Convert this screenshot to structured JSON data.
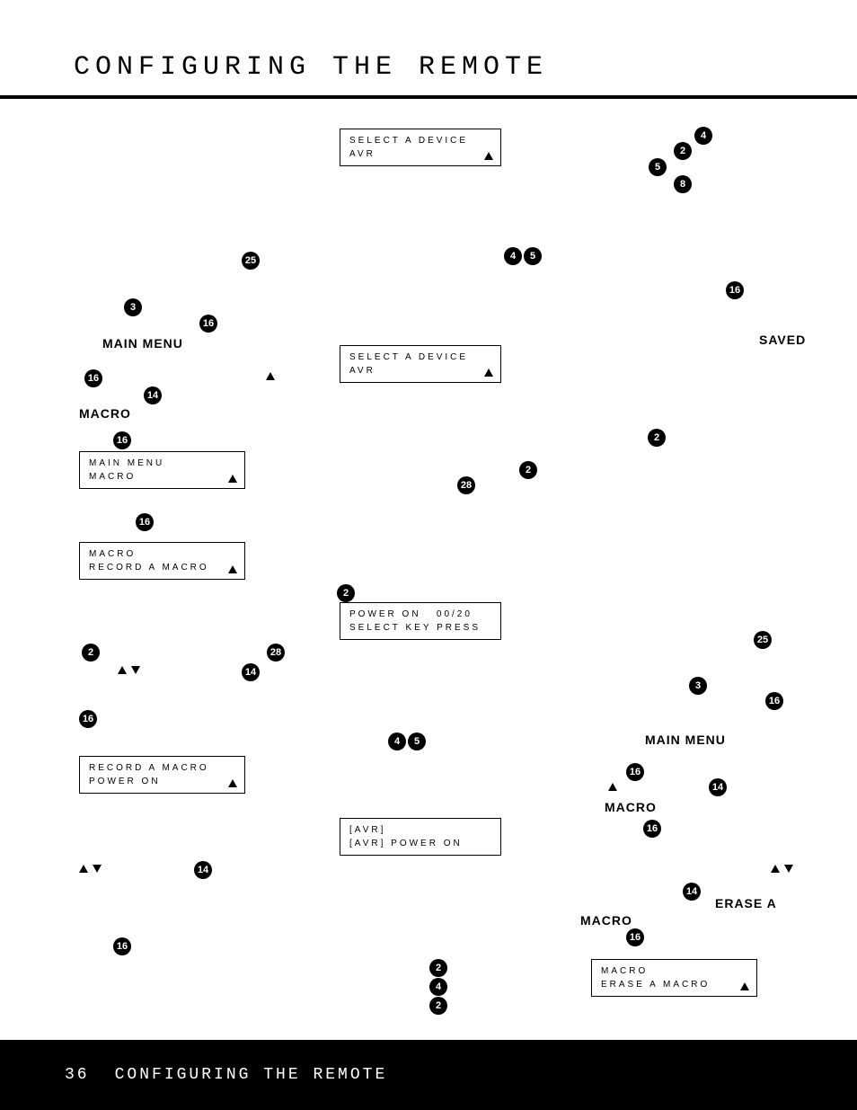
{
  "header": {
    "title": "CONFIGURING THE REMOTE"
  },
  "footer": {
    "page": "36",
    "title": "CONFIGURING THE REMOTE"
  },
  "labels": {
    "main_menu_1": "MAIN MENU",
    "macro_1": "MACRO",
    "saved": "SAVED",
    "main_menu_2": "MAIN MENU",
    "macro_2": "MACRO",
    "erase_a": "ERASE A",
    "macro_3": "MACRO"
  },
  "lcd": {
    "select_device_1": {
      "l1": "SELECT A DEVICE",
      "l2": "AVR"
    },
    "select_device_2": {
      "l1": "SELECT A DEVICE",
      "l2": "AVR"
    },
    "main_menu_macro": {
      "l1": "MAIN MENU",
      "l2": "MACRO"
    },
    "macro_record": {
      "l1": "MACRO",
      "l2": "RECORD A MACRO"
    },
    "power_on_select": {
      "l1": "POWER ON   00/20",
      "l2": "SELECT KEY PRESS"
    },
    "record_power_on": {
      "l1": "RECORD A MACRO",
      "l2": "POWER ON"
    },
    "avr_power_on": {
      "l1": "[AVR]",
      "l2": "[AVR] POWER ON"
    },
    "macro_erase": {
      "l1": "MACRO",
      "l2": "ERASE A MACRO"
    }
  },
  "badges": {
    "b2": "2",
    "b3": "3",
    "b4": "4",
    "b5": "5",
    "b8": "8",
    "b14": "14",
    "b16": "16",
    "b25": "25",
    "b28": "28"
  }
}
